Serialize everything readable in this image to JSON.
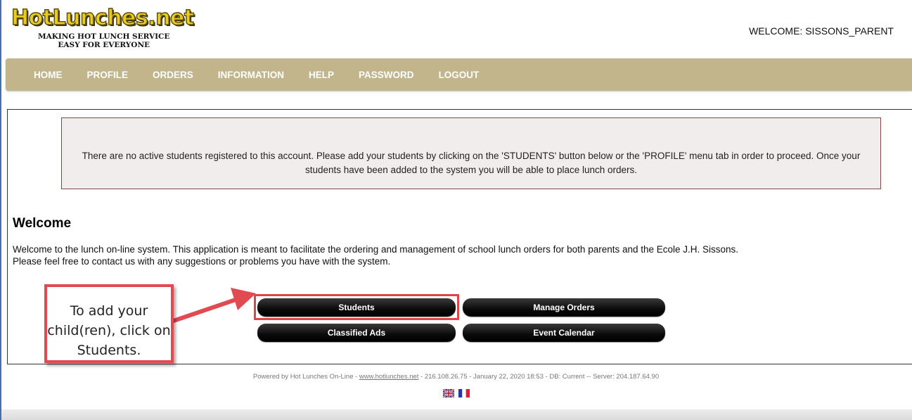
{
  "header": {
    "logo_title": "HotLunches.net",
    "logo_tagline_1": "MAKING HOT LUNCH SERVICE",
    "logo_tagline_2": "EASY FOR EVERYONE",
    "welcome_user": "WELCOME: SISSONS_PARENT"
  },
  "nav": {
    "items": [
      {
        "label": "HOME"
      },
      {
        "label": "PROFILE"
      },
      {
        "label": "ORDERS"
      },
      {
        "label": "INFORMATION"
      },
      {
        "label": "HELP"
      },
      {
        "label": "PASSWORD"
      },
      {
        "label": "LOGOUT"
      }
    ]
  },
  "alert": {
    "text": "There are no active students registered to this account. Please add your students by clicking on the 'STUDENTS' button below or the 'PROFILE' menu tab in order to proceed. Once your students have been added to the system you will be able to place lunch orders."
  },
  "main": {
    "heading": "Welcome",
    "text_line1": "Welcome to the lunch on-line system. This application is meant to facilitate the ordering and management of school lunch orders for both parents and the Ecole J.H. Sissons.",
    "text_line2": "Please feel free to contact us with any suggestions or problems you have with the system."
  },
  "buttons": {
    "students": "Students",
    "manage_orders": "Manage Orders",
    "classified_ads": "Classified Ads",
    "event_calendar": "Event Calendar"
  },
  "callout": {
    "text": "To add your child(ren), click on Students."
  },
  "footer": {
    "prefix": "Powered by Hot Lunches On-Line - ",
    "link": "www.hotlunches.net",
    "suffix": " - 216.108.26.75 - January 22, 2020 18:53 - DB: Current -- Server: 204.187.64.90"
  },
  "colors": {
    "nav_bg": "#c2b48b",
    "callout_border": "#e04a50",
    "button_bg": "#000000"
  }
}
